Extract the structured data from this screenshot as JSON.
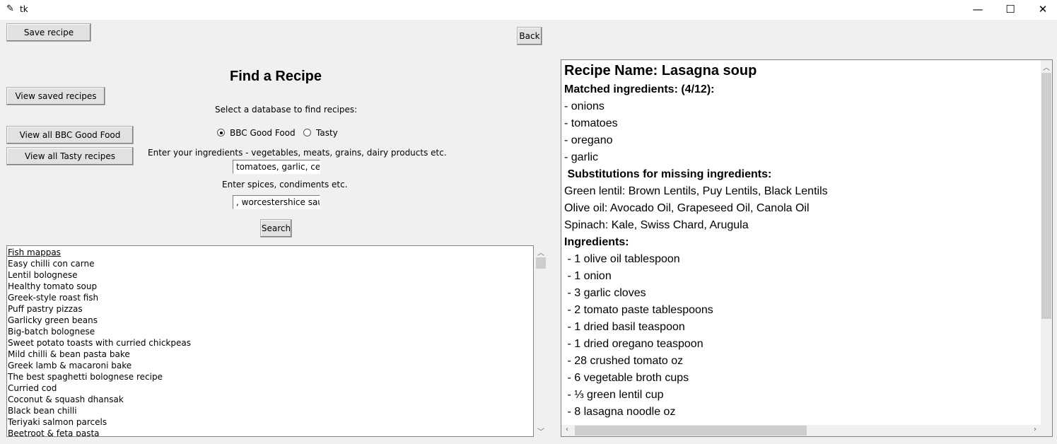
{
  "window": {
    "title": "tk",
    "minimize": "—",
    "maximize": "☐",
    "close": "✕"
  },
  "buttons": {
    "save": "Save recipe",
    "back": "Back",
    "view_saved": "View saved recipes",
    "view_bbc": "View all BBC Good Food recipes",
    "view_tasty": "View all Tasty recipes",
    "search": "Search"
  },
  "heading": "Find a Recipe",
  "select_db_label": "Select a database to find recipes:",
  "radios": [
    {
      "label": "BBC Good Food",
      "selected": true
    },
    {
      "label": "Tasty",
      "selected": false
    }
  ],
  "ingredients_label": "Enter your ingredients - vegetables, meats, grains, dairy products etc.",
  "ingredients_value": "tomatoes, garlic, celery",
  "spices_label": "Enter spices, condiments etc.",
  "spices_value": ", worcestershice sauce",
  "results": [
    "Fish mappas",
    "Easy chilli con carne",
    "Lentil bolognese",
    "Healthy tomato soup",
    "Greek-style roast fish",
    "Puff pastry pizzas",
    "Garlicky green beans",
    "Big-batch bolognese",
    "Sweet potato toasts with curried chickpeas",
    "Mild chilli & bean pasta bake",
    "Greek lamb & macaroni bake",
    "The best spaghetti bolognese recipe",
    "Curried cod",
    "Coconut & squash dhansak",
    "Black bean chilli",
    "Teriyaki salmon parcels",
    "Beetroot & feta pasta"
  ],
  "recipe": {
    "lines": [
      {
        "text": "Recipe Name: Lasagna soup",
        "style": "title"
      },
      {
        "text": "Matched ingredients: (4/12):",
        "style": "bold"
      },
      {
        "text": "- onions",
        "style": "normal"
      },
      {
        "text": "- tomatoes",
        "style": "normal"
      },
      {
        "text": "- oregano",
        "style": "normal"
      },
      {
        "text": "- garlic",
        "style": "normal"
      },
      {
        "text": " Substitutions for missing ingredients:",
        "style": "bold"
      },
      {
        "text": "Green lentil: Brown Lentils, Puy Lentils, Black Lentils",
        "style": "normal"
      },
      {
        "text": "Olive oil: Avocado Oil, Grapeseed Oil, Canola Oil",
        "style": "normal"
      },
      {
        "text": "Spinach: Kale, Swiss Chard, Arugula",
        "style": "normal"
      },
      {
        "text": "Ingredients:",
        "style": "bold"
      },
      {
        "text": " - 1 olive oil tablespoon",
        "style": "normal"
      },
      {
        "text": " - 1 onion",
        "style": "normal"
      },
      {
        "text": " - 3 garlic cloves",
        "style": "normal"
      },
      {
        "text": " - 2 tomato paste tablespoons",
        "style": "normal"
      },
      {
        "text": " - 1 dried basil teaspoon",
        "style": "normal"
      },
      {
        "text": " - 1 dried oregano teaspoon",
        "style": "normal"
      },
      {
        "text": " - 28 crushed tomato oz",
        "style": "normal"
      },
      {
        "text": " - 6 vegetable broth cups",
        "style": "normal"
      },
      {
        "text": " - ⅓ green lentil cup",
        "style": "normal"
      },
      {
        "text": " - 8 lasagna noodle oz",
        "style": "normal"
      }
    ]
  }
}
